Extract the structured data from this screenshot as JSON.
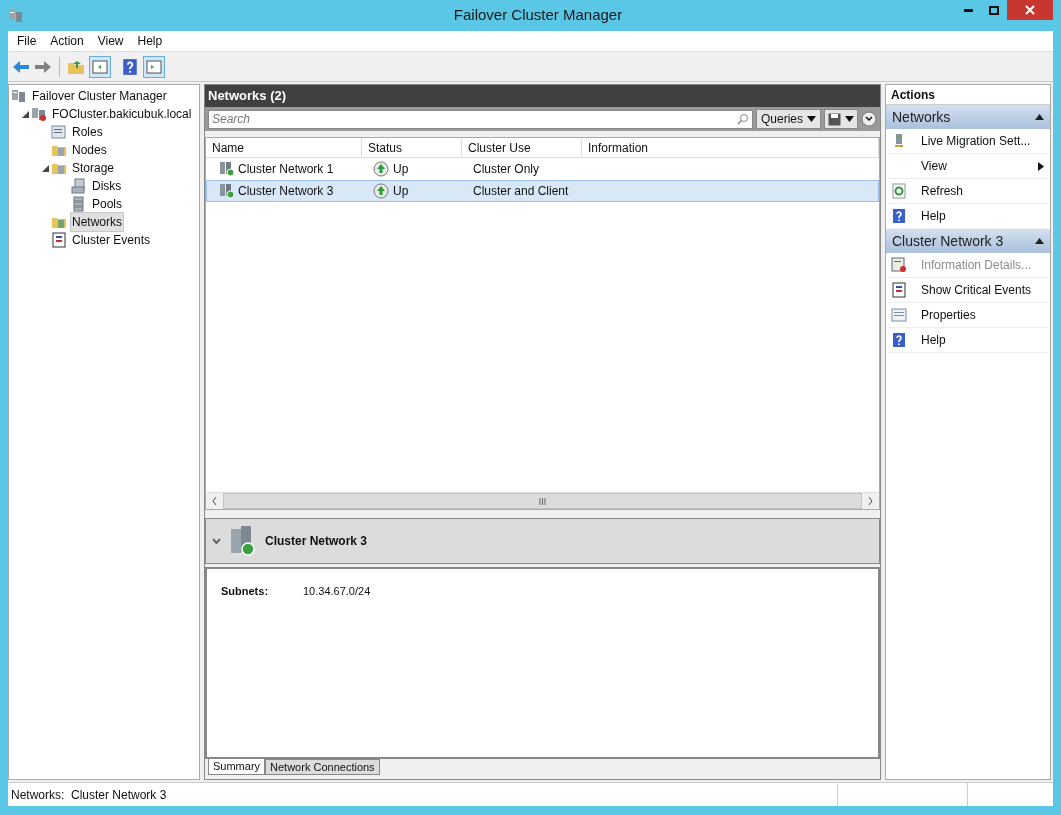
{
  "window": {
    "title": "Failover Cluster Manager"
  },
  "menu": [
    "File",
    "Action",
    "View",
    "Help"
  ],
  "tree": {
    "label": "Failover Cluster Manager",
    "kind": "cluster",
    "children": [
      {
        "label": "FOCluster.bakicubuk.local",
        "kind": "clusternode",
        "expanded": true,
        "selected": false,
        "children": [
          {
            "label": "Roles",
            "kind": "roles",
            "selected": false
          },
          {
            "label": "Nodes",
            "kind": "nodes",
            "selected": false
          },
          {
            "label": "Storage",
            "kind": "storage",
            "expanded": true,
            "selected": false,
            "children": [
              {
                "label": "Disks",
                "kind": "disk",
                "selected": false
              },
              {
                "label": "Pools",
                "kind": "pool",
                "selected": false
              }
            ]
          },
          {
            "label": "Networks",
            "kind": "network",
            "selected": true
          },
          {
            "label": "Cluster Events",
            "kind": "events",
            "selected": false
          }
        ]
      }
    ]
  },
  "center": {
    "title": "Networks (2)",
    "search": {
      "placeholder": "Search"
    },
    "queries": "Queries",
    "columns": [
      "Name",
      "Status",
      "Cluster Use",
      "Information"
    ],
    "rows": [
      {
        "name": "Cluster Network 1",
        "status": "Up",
        "cluster_use": "Cluster Only",
        "selected": false
      },
      {
        "name": "Cluster Network 3",
        "status": "Up",
        "cluster_use": "Cluster and Client",
        "selected": true
      }
    ]
  },
  "details": {
    "title": "Cluster Network 3",
    "fields": [
      {
        "label": "Subnets:",
        "value": "10.34.67.0/24"
      }
    ],
    "tabs": [
      {
        "label": "Summary",
        "selected": true
      },
      {
        "label": "Network Connections",
        "selected": false
      }
    ]
  },
  "actions": {
    "heading": "Actions",
    "sections": [
      {
        "title": "Networks",
        "items": [
          {
            "label": "Live Migration Sett...",
            "kind": "migration",
            "disabled": false,
            "submenu": false
          },
          {
            "label": "View",
            "kind": "blank",
            "disabled": false,
            "submenu": true
          },
          {
            "label": "Refresh",
            "kind": "refresh",
            "disabled": false,
            "submenu": false
          },
          {
            "label": "Help",
            "kind": "help",
            "disabled": false,
            "submenu": false
          }
        ]
      },
      {
        "title": "Cluster Network 3",
        "items": [
          {
            "label": "Information Details...",
            "kind": "info",
            "disabled": true,
            "submenu": false
          },
          {
            "label": "Show Critical Events",
            "kind": "events",
            "disabled": false,
            "submenu": false
          },
          {
            "label": "Properties",
            "kind": "properties",
            "disabled": false,
            "submenu": false
          },
          {
            "label": "Help",
            "kind": "help",
            "disabled": false,
            "submenu": false
          }
        ]
      }
    ]
  },
  "status_bar": {
    "text": "Networks:  Cluster Network 3"
  }
}
